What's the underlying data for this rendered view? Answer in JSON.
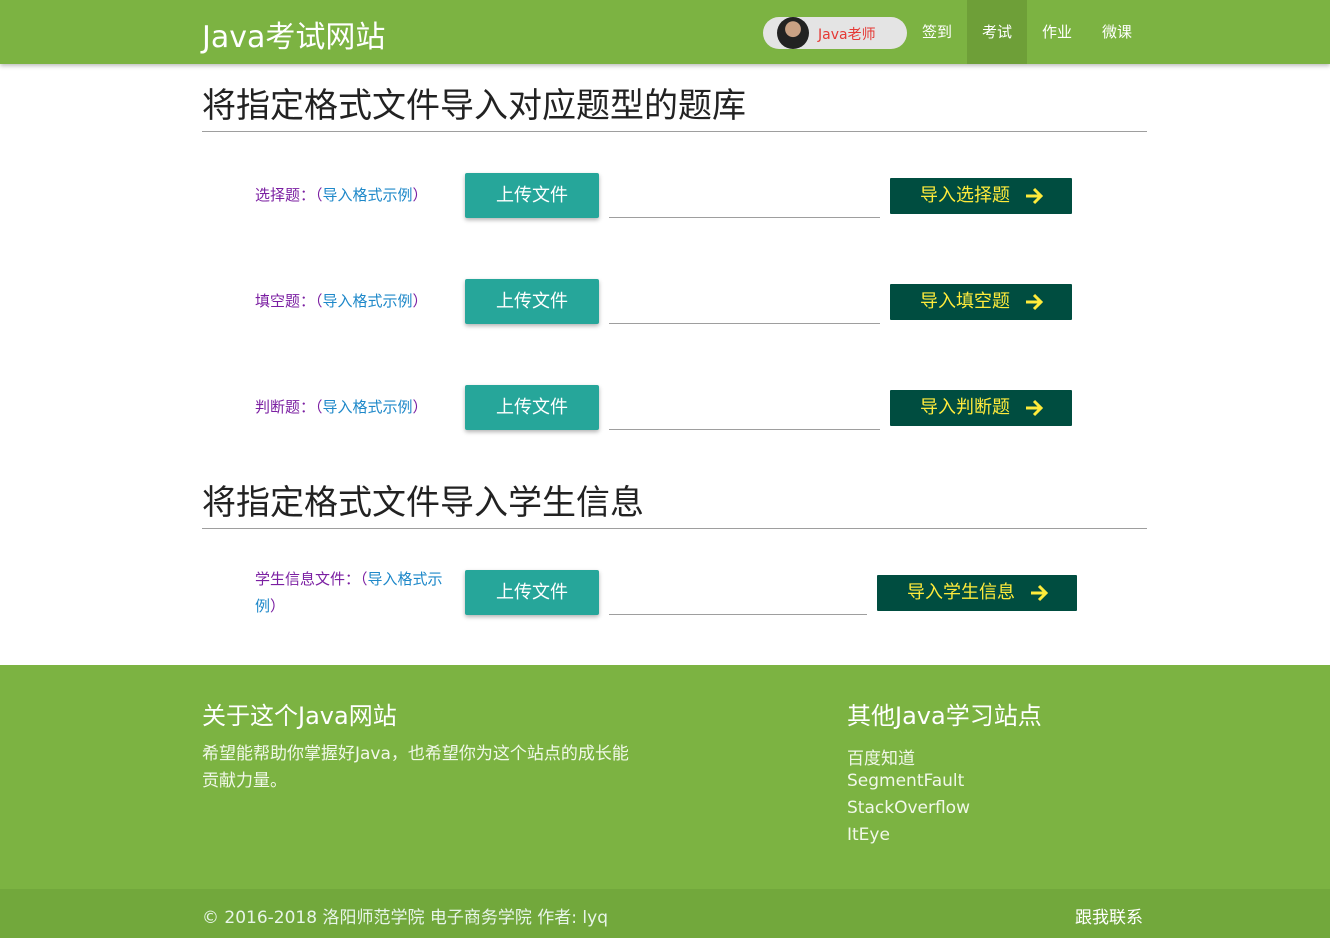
{
  "navbar": {
    "brand": "Java考试网站",
    "user_chip": {
      "label": "Java老师",
      "avatar": "teacher-avatar"
    },
    "items": [
      {
        "label": "签到",
        "active": false
      },
      {
        "label": "考试",
        "active": true
      },
      {
        "label": "作业",
        "active": false
      },
      {
        "label": "微课",
        "active": false
      }
    ]
  },
  "question_import": {
    "title": "将指定格式文件导入对应题型的题库",
    "rows": [
      {
        "label": "选择题：",
        "paren_open": "（",
        "example_link": "导入格式示例",
        "paren_close": "）",
        "upload_label": "上传文件",
        "file_value": "",
        "import_label": "导入选择题"
      },
      {
        "label": "填空题：",
        "paren_open": "（",
        "example_link": "导入格式示例",
        "paren_close": "）",
        "upload_label": "上传文件",
        "file_value": "",
        "import_label": "导入填空题"
      },
      {
        "label": "判断题：",
        "paren_open": "（",
        "example_link": "导入格式示例",
        "paren_close": "）",
        "upload_label": "上传文件",
        "file_value": "",
        "import_label": "导入判断题"
      }
    ]
  },
  "student_import": {
    "title": "将指定格式文件导入学生信息",
    "label": "学生信息文件：",
    "paren_open": "（",
    "example_link": "导入格式示例",
    "paren_close": "）",
    "upload_label": "上传文件",
    "file_value": "",
    "import_label": "导入学生信息"
  },
  "footer": {
    "about_title": "关于这个Java网站",
    "about_lines": [
      "希望能帮助你掌握好Java，也希望你为这个站点的成长能",
      "贡献力量。"
    ],
    "links_title": "其他Java学习站点",
    "links": [
      "百度知道",
      "SegmentFault",
      "StackOverflow",
      "ItEye"
    ],
    "copyright": "© 2016-2018 洛阳师范学院 电子商务学院  作者: lyq",
    "contact": "跟我联系"
  },
  "colors": {
    "primary_green": "#7cb342",
    "teal_button": "#26a69a",
    "dark_button": "#004d40",
    "button_text_yellow": "#ffeb3b",
    "label_purple": "#7b1fa2",
    "link_blue": "#1e88c9"
  }
}
